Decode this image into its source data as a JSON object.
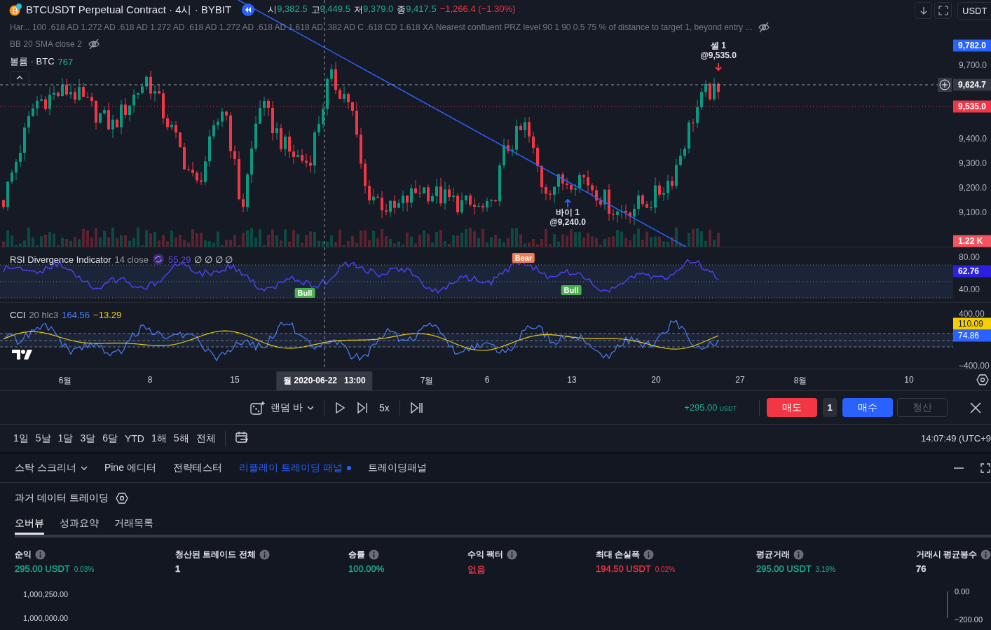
{
  "header": {
    "symbol": "BTCUSDT Perpetual Contract · 4시 · BYBIT",
    "ohlc": [
      {
        "label": "시",
        "value": "9,382.5"
      },
      {
        "label": "고",
        "value": "9,449.5"
      },
      {
        "label": "저",
        "value": "9,379.0"
      },
      {
        "label": "종",
        "value": "9,417.5"
      }
    ],
    "change": "−1,266.4 (−1.30%)",
    "currency": "USDT"
  },
  "indicators": [
    {
      "text": "Har...  100 .618 AD 1.272 AD .618 AD 1.272 AD .618 AD 1.272 AD .618 AD 1.618 AD .382 AD C .618 CD 1.618 XA Nearest confluent PRZ level 90 1 90 0.5 75 % of distance to target 1, beyond entry ...",
      "hidden": true
    },
    {
      "text": "BB 20 SMA close 2",
      "hidden": true
    }
  ],
  "volume": {
    "label": "볼륨 · BTC",
    "value": "767"
  },
  "price_axis": [
    "9,700.0",
    "9,400.0",
    "9,300.0",
    "9,200.0",
    "9,100.0"
  ],
  "price_labels": [
    {
      "kind": "tag",
      "text": "9,782.0",
      "color": "#2962ff"
    },
    {
      "kind": "crosshair",
      "text": "9,624.7"
    },
    {
      "kind": "tag",
      "text": "9,535.0",
      "color": "#f23645"
    },
    {
      "kind": "tag",
      "text": "1.22 K",
      "color": "#f7525f"
    }
  ],
  "trade_marks": [
    {
      "kind": "sell",
      "label": "셀 1",
      "price": "@9,535.0"
    },
    {
      "kind": "buy",
      "label": "바이 1",
      "price": "@9,240.0"
    }
  ],
  "rsi": {
    "title": "RSI Divergence Indicator",
    "params": "14 close",
    "value": "55.29",
    "extra": "∅ ∅ ∅ ∅",
    "axis": [
      "80.00",
      "40.00"
    ],
    "current": "62.76",
    "labels": [
      {
        "kind": "bull",
        "text": "Bull"
      },
      {
        "kind": "bear",
        "text": "Bear"
      },
      {
        "kind": "bull",
        "text": "Bull"
      }
    ]
  },
  "cci": {
    "title": "CCI",
    "params": "20 hlc3",
    "value": "164.56",
    "ma": "−13.29",
    "axis": [
      "400.00",
      "−400.00"
    ],
    "labels": [
      {
        "text": "110.09",
        "color": "#f5d000"
      },
      {
        "text": "74.86",
        "color": "#2962ff"
      }
    ]
  },
  "time_axis": [
    "6월",
    "8",
    "15",
    "7월",
    "6",
    "13",
    "20",
    "27",
    "8월",
    "10"
  ],
  "crosshair_time": "월 2020-06-22   13:00",
  "replay": {
    "mode": "랜덤 바",
    "speed": "5x",
    "pnl": "+295.00",
    "pnl_unit": "USDT",
    "sell": "매도",
    "qty": "1",
    "buy": "매수",
    "close": "청산",
    "close_disabled": true
  },
  "ranges": [
    "1일",
    "5날",
    "1달",
    "3달",
    "6달",
    "YTD",
    "1해",
    "5해",
    "전체"
  ],
  "clock": "14:07:49 (UTC+9",
  "panel_tabs": [
    {
      "label": "스탁 스크리너",
      "selected": false,
      "dropdown": true
    },
    {
      "label": "Pine 에디터",
      "selected": false,
      "dropdown": false
    },
    {
      "label": "전략테스터",
      "selected": false,
      "dropdown": false
    },
    {
      "label": "리플레이 트레이딩 패널",
      "selected": true,
      "dropdown": false
    },
    {
      "label": "트레이딩패널",
      "selected": false,
      "dropdown": false
    }
  ],
  "panel": {
    "title": "과거 데이터 트레이딩",
    "subtabs": [
      {
        "label": "오버뷰",
        "selected": true
      },
      {
        "label": "성과요약",
        "selected": false
      },
      {
        "label": "거래목록",
        "selected": false
      }
    ],
    "metrics": [
      {
        "label": "순익",
        "value": "295.00 USDT",
        "sub": "0.03%",
        "color": "#22ab94"
      },
      {
        "label": "청산된 트레이드 전체",
        "value": "1",
        "color": "#d1d4dc"
      },
      {
        "label": "승률",
        "value": "100.00%",
        "color": "#22ab94"
      },
      {
        "label": "수익 팩터",
        "value": "없음",
        "color": "#f23645"
      },
      {
        "label": "최대 손실폭",
        "value": "194.50 USDT",
        "sub": "0.02%",
        "color": "#f23645"
      },
      {
        "label": "평균거래",
        "value": "295.00 USDT",
        "sub": "3.19%",
        "color": "#22ab94"
      },
      {
        "label": "거래시 평균봉수",
        "value": "76",
        "color": "#d1d4dc"
      }
    ],
    "left_axis": [
      "1,000,250.00",
      "1,000,000.00"
    ],
    "right_axis": [
      "0.00",
      "−200.00"
    ]
  }
}
